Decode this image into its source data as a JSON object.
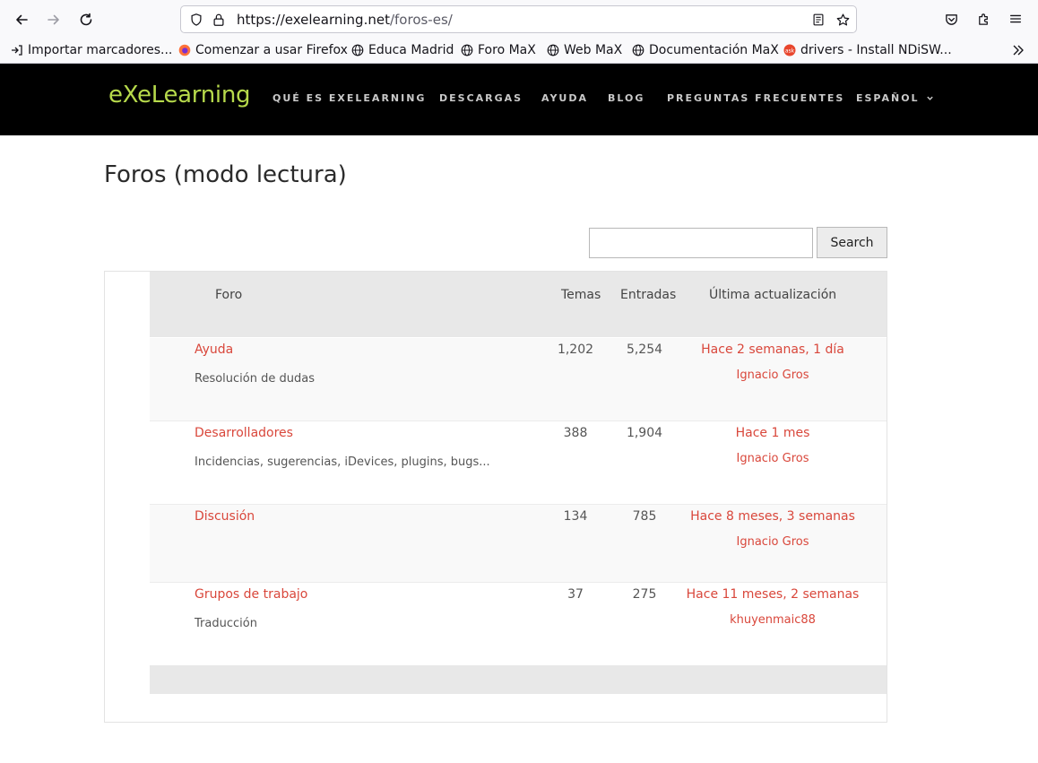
{
  "browser": {
    "url_host": "https://exelearning.net",
    "url_path": "/foros-es/",
    "bookmarks": [
      {
        "label": "Importar marcadores...",
        "icon": "import-icon"
      },
      {
        "label": "Comenzar a usar Firefox",
        "icon": "firefox-icon"
      },
      {
        "label": "Educa Madrid",
        "icon": "globe-icon"
      },
      {
        "label": "Foro MaX",
        "icon": "globe-icon"
      },
      {
        "label": "Web MaX",
        "icon": "globe-icon"
      },
      {
        "label": "Documentación MaX",
        "icon": "globe-icon"
      },
      {
        "label": "drivers - Install NDiSW...",
        "icon": "ask-icon"
      }
    ]
  },
  "site": {
    "logo": "eXeLearning",
    "nav": [
      "QUÉ ES EXELEARNING",
      "DESCARGAS",
      "AYUDA",
      "BLOG",
      "PREGUNTAS FRECUENTES",
      "ESPAÑOL"
    ]
  },
  "page": {
    "title": "Foros (modo lectura)",
    "search_button": "Search",
    "search_value": ""
  },
  "table": {
    "headers": {
      "forum": "Foro",
      "topics": "Temas",
      "posts": "Entradas",
      "last_update": "Última actualización"
    },
    "rows": [
      {
        "name": "Ayuda",
        "description": "Resolución de dudas",
        "topics": "1,202",
        "posts": "5,254",
        "updated": "Hace 2 semanas, 1 día",
        "author": "Ignacio Gros"
      },
      {
        "name": "Desarrolladores",
        "description": "Incidencias, sugerencias, iDevices, plugins, bugs...",
        "topics": "388",
        "posts": "1,904",
        "updated": "Hace 1 mes",
        "author": "Ignacio Gros"
      },
      {
        "name": "Discusión",
        "description": "",
        "topics": "134",
        "posts": "785",
        "updated": "Hace 8 meses, 3 semanas",
        "author": "Ignacio Gros"
      },
      {
        "name": "Grupos de trabajo",
        "description": "Traducción",
        "topics": "37",
        "posts": "275",
        "updated": "Hace 11 meses, 2 semanas",
        "author": "khuyenmaic88"
      }
    ]
  },
  "colors": {
    "logo": "#b6d94b",
    "link": "#d9473b",
    "header_bg": "#000000",
    "table_head_bg": "#e8e8e8"
  }
}
